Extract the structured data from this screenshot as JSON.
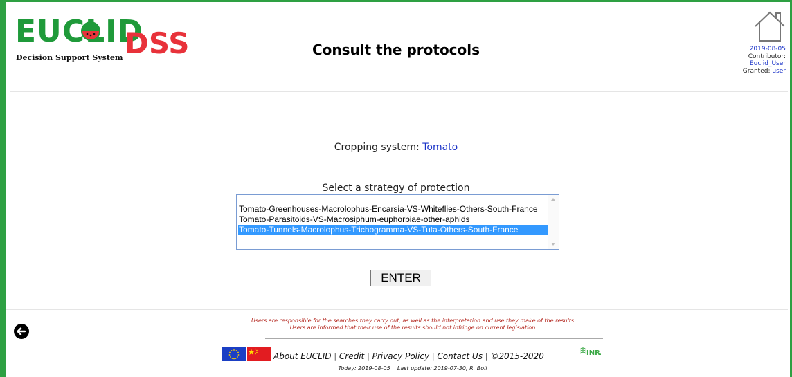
{
  "header": {
    "logo_main": "EUCLID",
    "logo_dss": "DSS",
    "logo_subtitle": "Decision Support System",
    "title": "Consult the protocols",
    "user": {
      "date": "2019-08-05",
      "contributor_label": "Contributor:",
      "contributor_name": "Euclid_User",
      "granted_label": "Granted:",
      "granted_value": "user"
    }
  },
  "main": {
    "cropping_label": "Cropping system:",
    "cropping_value": "Tomato",
    "strategy_label": "Select a strategy of protection",
    "strategies": [
      "Tomato-Greenhouses-Macrolophus-Encarsia-VS-Whiteflies-Others-South-France",
      "Tomato-Parasitoids-VS-Macrosiphum-euphorbiae-other-aphids",
      "Tomato-Tunnels-Macrolophus-Trichogramma-VS-Tuta-Others-South-France"
    ],
    "selected_strategy_index": 2,
    "enter_label": "ENTER"
  },
  "footer": {
    "disclaimer_1": "Users are responsible for the searches they carry out, as well as the interpretation and use they make of the results",
    "disclaimer_2": "Users are informed that their use of the results should not infringe on current legislation",
    "links": {
      "about": "About EUCLID",
      "credit": "Credit",
      "privacy": "Privacy Policy",
      "contact": "Contact Us",
      "copyright": "©2015-2020"
    },
    "separator": "|",
    "inra": "INRA",
    "today": "Today: 2019-08-05",
    "last_update": "Last update: 2019-07-30, R. Boll"
  },
  "colors": {
    "frame_green": "#2ea043",
    "logo_green": "#1f9a3a",
    "logo_red": "#e8323a",
    "link_blue": "#1a33c8",
    "disclaimer_red": "#b3261e",
    "selection_blue": "#3399ff"
  },
  "icons": {
    "home": "home-icon",
    "back": "back-arrow-icon",
    "eu_flag": "eu-flag-icon",
    "china_flag": "china-flag-icon"
  }
}
